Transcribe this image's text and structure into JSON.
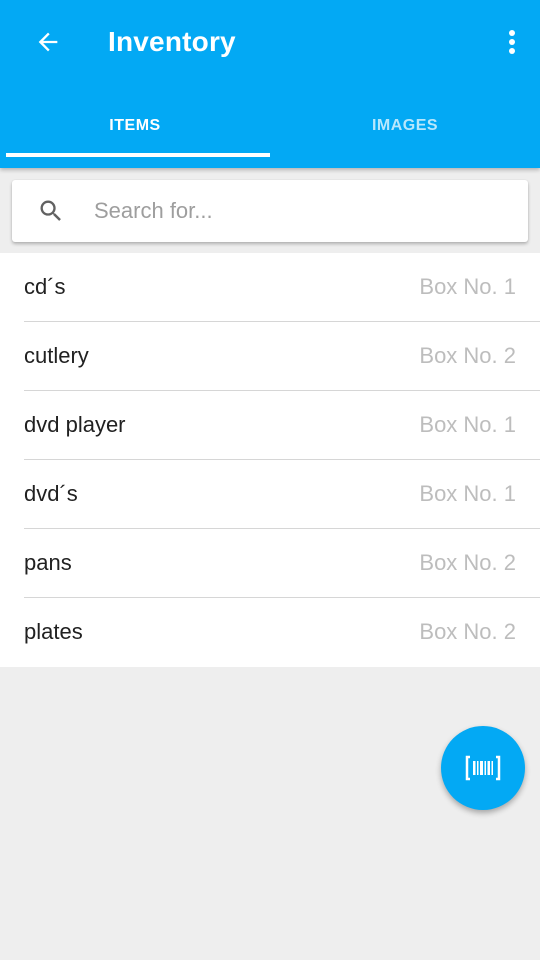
{
  "colors": {
    "primary": "#03a9f4",
    "background": "#eeeeee",
    "secondary_text": "#bdbdbd"
  },
  "toolbar": {
    "title": "Inventory",
    "back_icon": "arrow-back-icon",
    "menu_icon": "more-vert-icon"
  },
  "tabs": [
    {
      "label": "ITEMS",
      "active": true
    },
    {
      "label": "IMAGES",
      "active": false
    }
  ],
  "search": {
    "placeholder": "Search for...",
    "value": "",
    "icon": "search-icon"
  },
  "items": [
    {
      "name": "cd´s",
      "box": "Box No. 1"
    },
    {
      "name": "cutlery",
      "box": "Box No. 2"
    },
    {
      "name": "dvd player",
      "box": "Box No. 1"
    },
    {
      "name": "dvd´s",
      "box": "Box No. 1"
    },
    {
      "name": "pans",
      "box": "Box No. 2"
    },
    {
      "name": "plates",
      "box": "Box No. 2"
    }
  ],
  "fab": {
    "icon": "barcode-scan-icon"
  }
}
